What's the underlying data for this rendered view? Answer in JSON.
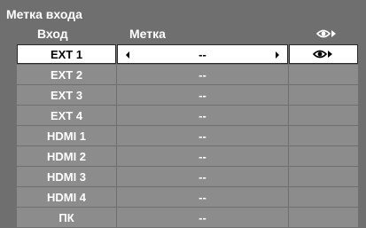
{
  "title": "Метка входа",
  "columns": {
    "input": "Вход",
    "label": "Метка",
    "icon": "eye-arrow-icon"
  },
  "rows": [
    {
      "input": "EXT 1",
      "label": "--",
      "selected": true,
      "icon": "eye-arrow-icon"
    },
    {
      "input": "EXT 2",
      "label": "--",
      "selected": false
    },
    {
      "input": "EXT 3",
      "label": "--",
      "selected": false
    },
    {
      "input": "EXT 4",
      "label": "--",
      "selected": false
    },
    {
      "input": "HDMI 1",
      "label": "--",
      "selected": false
    },
    {
      "input": "HDMI 2",
      "label": "--",
      "selected": false
    },
    {
      "input": "HDMI 3",
      "label": "--",
      "selected": false
    },
    {
      "input": "HDMI 4",
      "label": "--",
      "selected": false
    },
    {
      "input": "ПК",
      "label": "--",
      "selected": false
    }
  ],
  "colors": {
    "panel": "#6f6f6f",
    "cell": "#8c8c8c",
    "selected": "#ffffff"
  }
}
